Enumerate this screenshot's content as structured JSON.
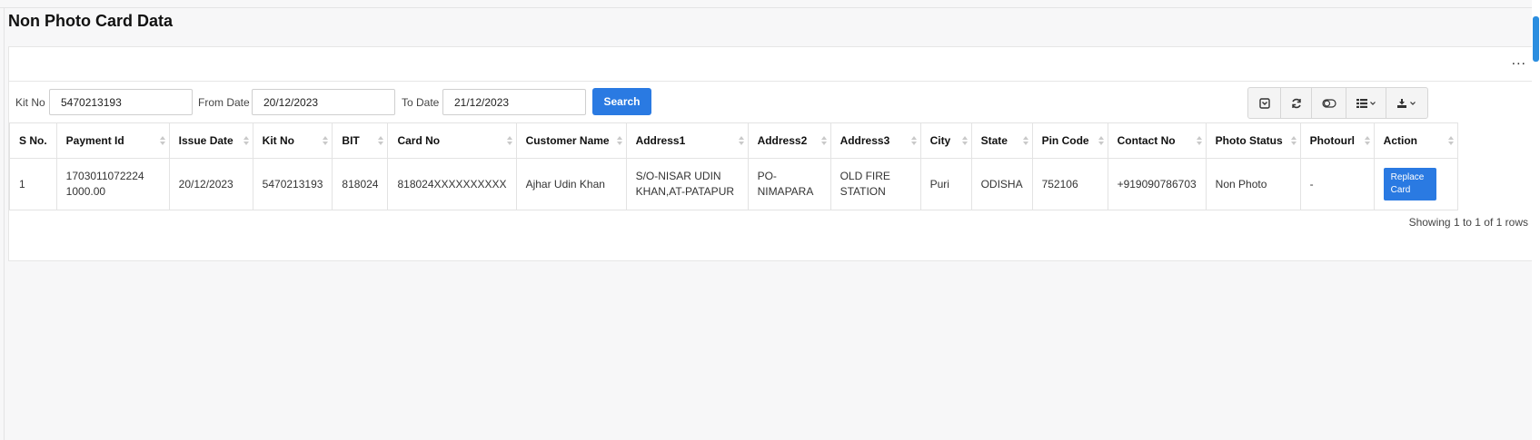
{
  "page": {
    "title": "Non Photo Card Data"
  },
  "filters": {
    "kit_no_label": "Kit No :",
    "kit_no_value": "5470213193",
    "from_date_label": "From Date :",
    "from_date_value": "20/12/2023",
    "to_date_label": "To Date :",
    "to_date_value": "21/12/2023",
    "search_label": "Search"
  },
  "toolbar": {
    "menu_label": "...",
    "icons": [
      "toggle-icon",
      "refresh-icon",
      "columns-toggle-icon",
      "list-columns-icon",
      "export-icon"
    ]
  },
  "table": {
    "columns": [
      "S No.",
      "Payment Id",
      "Issue Date",
      "Kit No",
      "BIT",
      "Card No",
      "Customer Name",
      "Address1",
      "Address2",
      "Address3",
      "City",
      "State",
      "Pin Code",
      "Contact No",
      "Photo Status",
      "Photourl",
      "Action"
    ],
    "rows": [
      {
        "s_no": "1",
        "payment_id_line1": "1703011072224",
        "payment_id_line2": "1000.00",
        "issue_date": "20/12/2023",
        "kit_no": "5470213193",
        "bit": "818024",
        "card_no": "818024XXXXXXXXXX",
        "customer_name": "Ajhar Udin Khan",
        "address1_line1": "S/O-NISAR UDIN",
        "address1_line2": "KHAN,AT-PATAPUR",
        "address2_line1": "PO-",
        "address2_line2": "NIMAPARA",
        "address3_line1": "OLD FIRE",
        "address3_line2": "STATION",
        "city": "Puri",
        "state": "ODISHA",
        "pin_code": "752106",
        "contact_no": "+919090786703",
        "photo_status": "Non Photo",
        "photourl": "-",
        "action_line1": "Replace",
        "action_line2": "Card"
      }
    ],
    "footer": "Showing 1 to 1 of 1 rows"
  },
  "colors": {
    "accent": "#2a7ae2",
    "scrollbar": "#2b8ee0"
  }
}
